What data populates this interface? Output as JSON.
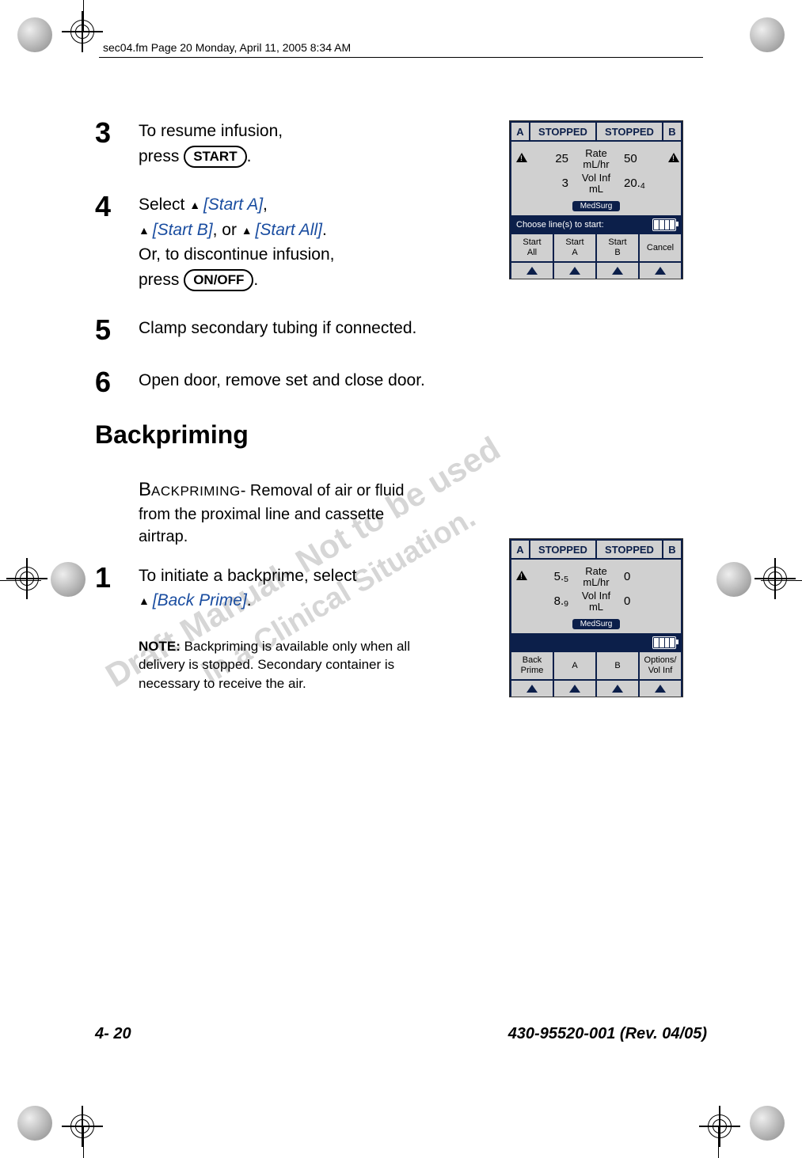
{
  "page_meta_header": "sec04.fm  Page 20  Monday, April 11, 2005  8:34 AM",
  "steps": {
    "s3": {
      "num": "3",
      "text_a": "To resume infusion,",
      "text_b": "press ",
      "key": "START",
      "text_c": "."
    },
    "s4": {
      "num": "4",
      "text_a": "Select ",
      "opt_a": "[Start A]",
      "comma1": ",",
      "opt_b": "[Start B]",
      "or": ", or ",
      "opt_c": "[Start All]",
      "period": ".",
      "line2": "Or, to discontinue infusion,",
      "line3a": "press ",
      "key": "ON/OFF",
      "line3b": "."
    },
    "s5": {
      "num": "5",
      "text": "Clamp secondary tubing if connected."
    },
    "s6": {
      "num": "6",
      "text": "Open door, remove set and close door."
    }
  },
  "section_heading": "Backpriming",
  "body1a": "B",
  "body1b": "ACKPRIMING",
  "body1c": "- Removal of air or fluid from the proximal line and cassette airtrap.",
  "step_bp": {
    "num": "1",
    "text_a": "To initiate a backprime, select ",
    "opt": "[Back Prime]",
    "text_b": "."
  },
  "note": {
    "label": "NOTE:",
    "text": " Backpriming is available only when all delivery is stopped. Secondary container is necessary to receive the air."
  },
  "device1": {
    "a": "A",
    "b": "B",
    "st1": "STOPPED",
    "st2": "STOPPED",
    "rate_label": "Rate\nmL/hr",
    "vol_label": "Vol Inf\nmL",
    "rate_l": "25",
    "rate_r": "50",
    "vol_l": "3",
    "vol_r_whole": "20.",
    "vol_r_frac": "4",
    "cca": "MedSurg",
    "bar": "Choose line(s) to start:",
    "sk1": "Start\nAll",
    "sk2": "Start\nA",
    "sk3": "Start\nB",
    "sk4": "Cancel"
  },
  "device2": {
    "a": "A",
    "b": "B",
    "st1": "STOPPED",
    "st2": "STOPPED",
    "rate_label": "Rate\nmL/hr",
    "vol_label": "Vol Inf\nmL",
    "rate_l_whole": "5.",
    "rate_l_frac": "5",
    "rate_r": "0",
    "vol_l_whole": "8.",
    "vol_l_frac": "9",
    "vol_r": "0",
    "cca": "MedSurg",
    "sk1": "Back\nPrime",
    "sk2": "A",
    "sk3": "B",
    "sk4": "Options/\nVol Inf"
  },
  "watermarks": {
    "w1": "Draft Manual- Not to be used",
    "w2": "in a Clinical Situation."
  },
  "footer": {
    "left": "4- 20",
    "right": "430-95520-001 (Rev. 04/05)"
  }
}
